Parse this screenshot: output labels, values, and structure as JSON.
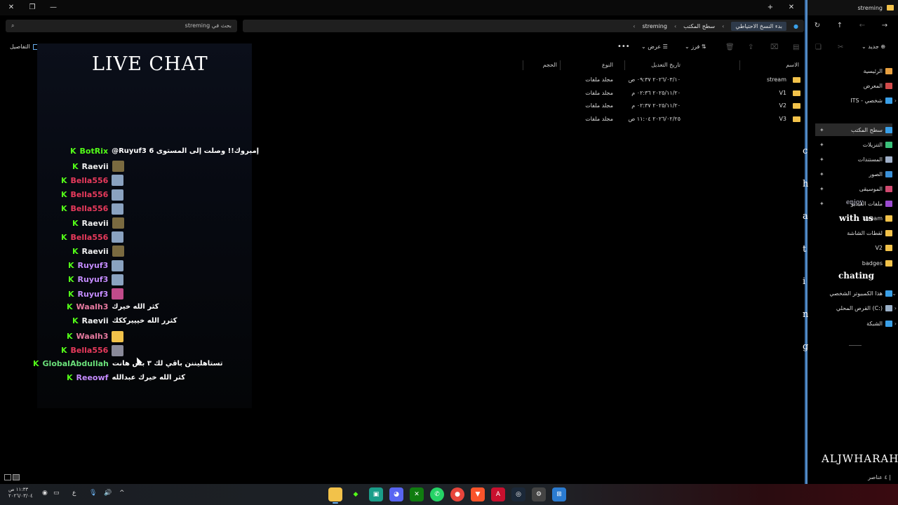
{
  "titlebar": {
    "tab_title": "streming",
    "close_label": "✕",
    "newtab_label": "+"
  },
  "address": {
    "search_placeholder": "بحث في streming",
    "crumbs": [
      "بدء النسخ الاحتياطي",
      "سطح المكتب",
      "streming"
    ]
  },
  "toolbar": {
    "new_label": "جديد",
    "sort_label": "فرز",
    "view_label": "عرض",
    "more_label": "•••",
    "details_label": "التفاصيل"
  },
  "chat": {
    "title": "LIVE CHAT",
    "badge": "K",
    "messages": [
      {
        "user": "BotRix",
        "color": "#53fc18",
        "text": "@Ruyuf3 إمبروك!! وصلت إلى المستوى 6",
        "emote": ""
      },
      {
        "user": "Raevii",
        "color": "#f0f0f0",
        "text": "",
        "emote": "#7a6a40"
      },
      {
        "user": "Bella556",
        "color": "#e83a5c",
        "text": "",
        "emote": "#8aa2c0"
      },
      {
        "user": "Bella556",
        "color": "#e83a5c",
        "text": "",
        "emote": "#8aa2c0"
      },
      {
        "user": "Bella556",
        "color": "#e83a5c",
        "text": "",
        "emote": "#8aa2c0"
      },
      {
        "user": "Raevii",
        "color": "#f0f0f0",
        "text": "",
        "emote": "#7a6a40"
      },
      {
        "user": "Bella556",
        "color": "#e83a5c",
        "text": "",
        "emote": "#8aa2c0"
      },
      {
        "user": "Raevii",
        "color": "#f0f0f0",
        "text": "",
        "emote": "#7a6a40"
      },
      {
        "user": "Ruyuf3",
        "color": "#c58cff",
        "text": "",
        "emote": "#8aa2c0"
      },
      {
        "user": "Ruyuf3",
        "color": "#c58cff",
        "text": "",
        "emote": "#8aa2c0"
      },
      {
        "user": "Ruyuf3",
        "color": "#c58cff",
        "text": "",
        "emote": "#c04b8a"
      },
      {
        "user": "Waalh3",
        "color": "#e87aa0",
        "text": "كثر الله خيرك",
        "emote": ""
      },
      {
        "user": "Raevii",
        "color": "#f0f0f0",
        "text": "كثرر الله خيييرككك",
        "emote": ""
      },
      {
        "user": "Waalh3",
        "color": "#e87aa0",
        "text": "",
        "emote": "#f2c24a"
      },
      {
        "user": "Bella556",
        "color": "#e83a5c",
        "text": "",
        "emote": "#8a8a9a"
      },
      {
        "user": "GlobalAbdullah",
        "color": "#6ae07a",
        "text": "تستاهليننن باقي لك ٣ بس هانت",
        "emote": ""
      },
      {
        "user": "Reeowf",
        "color": "#c58cff",
        "text": "كثر الله خيرك عبدالله",
        "emote": ""
      }
    ]
  },
  "files": {
    "headers": {
      "name": "الاسم",
      "date": "تاريخ التعديل",
      "type": "النوع",
      "size": "الحجم"
    },
    "rows": [
      {
        "name": "stream",
        "date": "٢٠٢٦/٠٣/١٠ ٠٩:٣٧ ص",
        "type": "مجلد ملفات"
      },
      {
        "name": "V1",
        "date": "٢٠٢٥/١١/٢٠ ٠٢:٣٦ م",
        "type": "مجلد ملفات"
      },
      {
        "name": "V2",
        "date": "٢٠٢٥/١١/٢٠ ٠٢:٣٧ م",
        "type": "مجلد ملفات"
      },
      {
        "name": "V3",
        "date": "٢٠٢٦/٠٢/٢٥ ١١:٠٤ ص",
        "type": "مجلد ملفات"
      }
    ]
  },
  "vertical_text": [
    "c",
    "h",
    "a",
    "t",
    "i",
    "n",
    "g"
  ],
  "sidebar": {
    "items": [
      {
        "label": "الرئيسية",
        "color": "#e8a040"
      },
      {
        "label": "المعرض",
        "color": "#d04a4a"
      },
      {
        "label": "ITS - شخصي",
        "color": "#3aa0e8"
      },
      {
        "label": "سطح المكتب",
        "color": "#3aa0e8"
      },
      {
        "label": "التنزيلات",
        "color": "#3ac07a"
      },
      {
        "label": "المستندات",
        "color": "#a0b0c8"
      },
      {
        "label": "الصور",
        "color": "#3a90d8"
      },
      {
        "label": "الموسيقى",
        "color": "#d04a70"
      },
      {
        "label": "ملفات الفيديو",
        "color": "#9a4ad0"
      },
      {
        "label": "stream",
        "color": "#f2c24a"
      },
      {
        "label": "لقطات الشاشة",
        "color": "#f2c24a"
      },
      {
        "label": "V2",
        "color": "#f2c24a"
      },
      {
        "label": "badges",
        "color": "#f2c24a"
      },
      {
        "label": "هذا الكمبيوتر الشخصي",
        "color": "#3aa0e8"
      },
      {
        "label": "القرص المحلي (C:)",
        "color": "#9ab0c8"
      },
      {
        "label": "الشبكة",
        "color": "#3aa0e8"
      }
    ],
    "overlay_words": [
      "enjoy",
      "with us",
      "chating"
    ]
  },
  "brand": "ALJWHARAH",
  "status": {
    "count": "٤ عناصر"
  },
  "taskbar": {
    "time": "١١:٣٣ ص",
    "date": "٢٠٢٦/٠٣/٠٤",
    "lang": "ع"
  }
}
